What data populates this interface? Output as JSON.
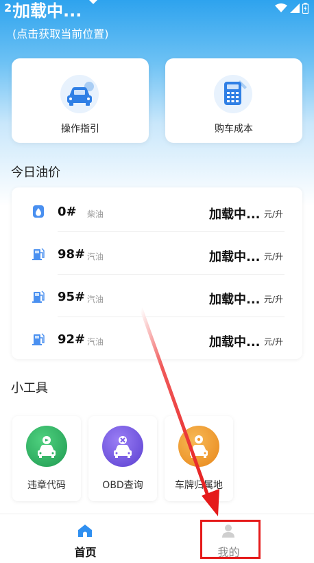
{
  "status_bar": {
    "time": "2:"
  },
  "header": {
    "title": "加载中...",
    "location_hint": "(点击获取当前位置)"
  },
  "quick_actions": [
    {
      "label": "操作指引",
      "icon": "car-icon"
    },
    {
      "label": "购车成本",
      "icon": "calculator-icon"
    }
  ],
  "oil_section": {
    "title": "今日油价",
    "rows": [
      {
        "grade": "0#",
        "kind": "柴油",
        "price": "加载中...",
        "unit": "元/升"
      },
      {
        "grade": "98#",
        "kind": "汽油",
        "price": "加载中...",
        "unit": "元/升"
      },
      {
        "grade": "95#",
        "kind": "汽油",
        "price": "加载中...",
        "unit": "元/升"
      },
      {
        "grade": "92#",
        "kind": "汽油",
        "price": "加载中...",
        "unit": "元/升"
      }
    ]
  },
  "tools_section": {
    "title": "小工具",
    "items": [
      {
        "label": "违章代码",
        "color": "#2bb062"
      },
      {
        "label": "OBD查询",
        "color": "#7b5ce8"
      },
      {
        "label": "车牌归属地",
        "color": "#f29a2e"
      }
    ]
  },
  "tab_bar": {
    "tabs": [
      {
        "label": "首页",
        "active": true
      },
      {
        "label": "我的",
        "active": false
      }
    ]
  },
  "colors": {
    "accent_blue": "#2ea3ee",
    "annotation_red": "#e51a1a"
  }
}
